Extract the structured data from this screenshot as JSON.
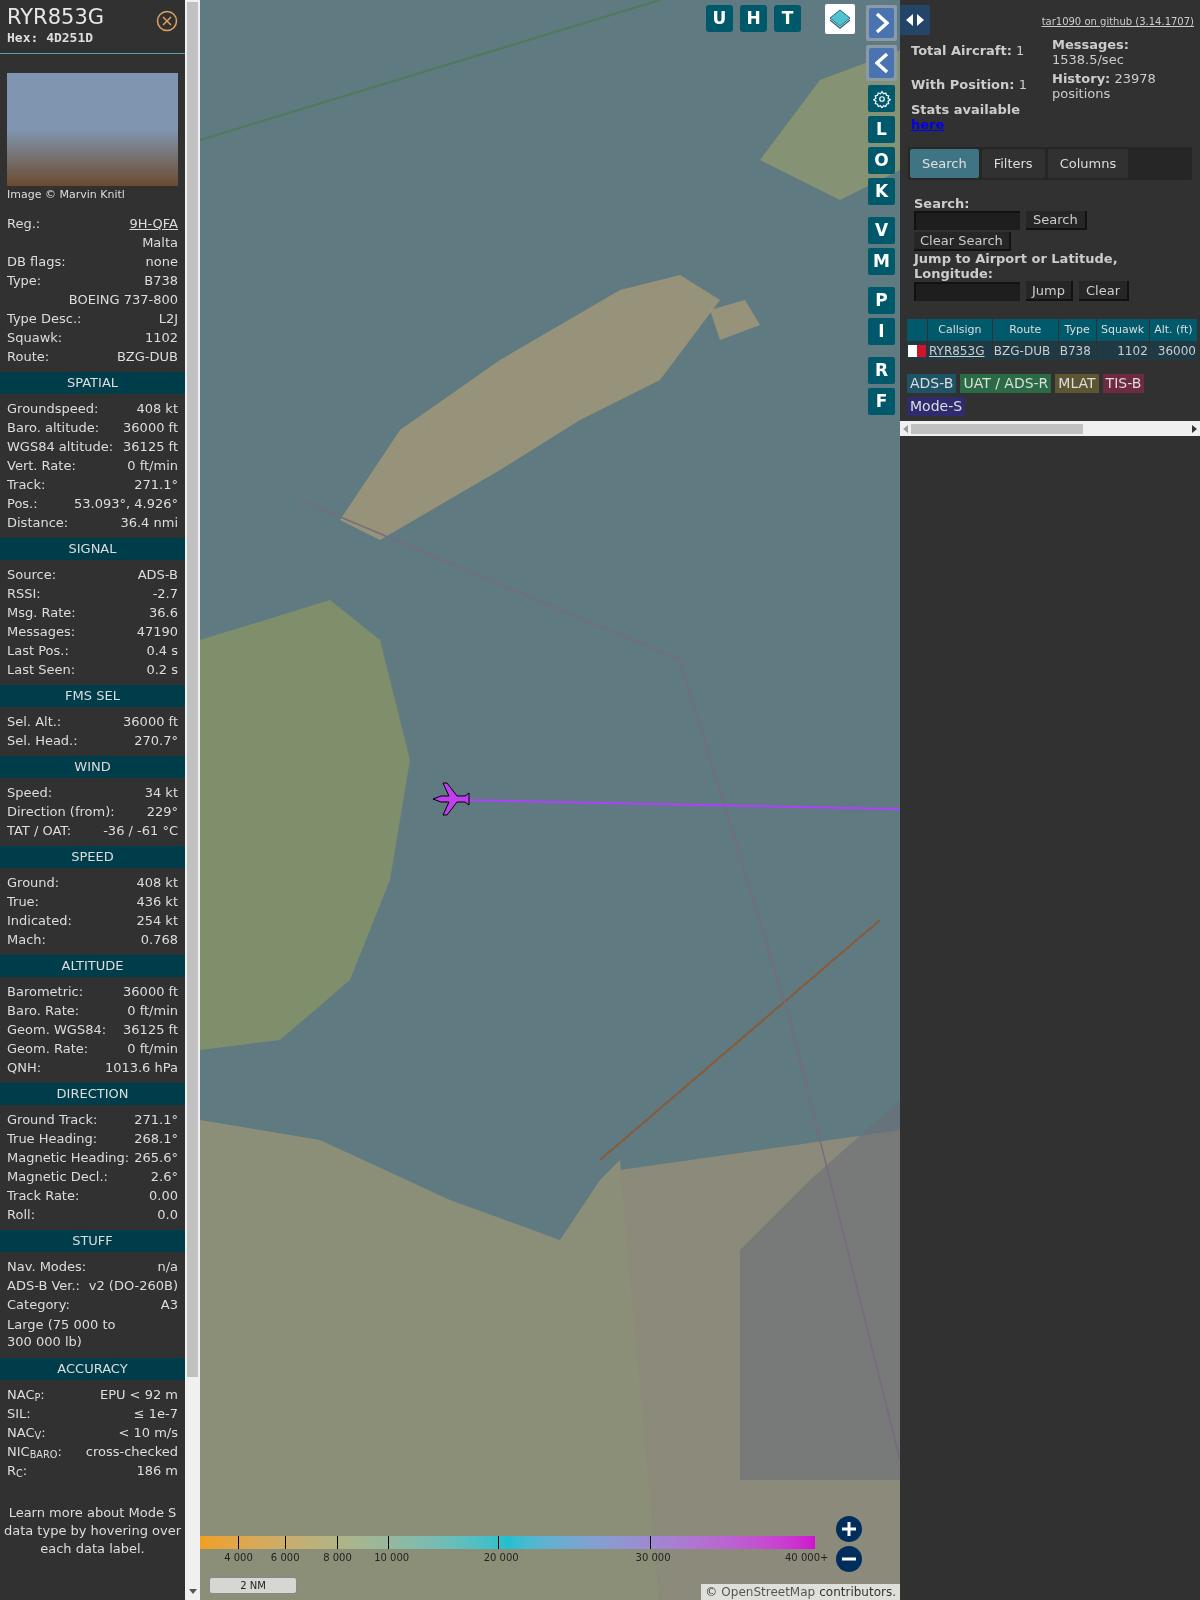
{
  "aircraft": {
    "callsign": "RYR853G",
    "hex": "Hex: 4D251D",
    "photo_credit": "Image © Marvin Knitl"
  },
  "sections": [
    {
      "rows": [
        {
          "kind": "link",
          "label": "Reg.:",
          "value": "9H-QFA"
        },
        {
          "kind": "value",
          "value": "Malta"
        },
        {
          "kind": "pair",
          "label": "DB flags:",
          "value": "none"
        },
        {
          "kind": "pair",
          "label": "Type:",
          "value": "B738"
        },
        {
          "kind": "value",
          "value": "BOEING 737-800"
        },
        {
          "kind": "pair",
          "label": "Type Desc.:",
          "value": "L2J"
        },
        {
          "kind": "pair",
          "label": "Squawk:",
          "value": "1102"
        },
        {
          "kind": "pair",
          "label": "Route:",
          "value": "BZG-DUB"
        }
      ]
    },
    {
      "title": "SPATIAL",
      "rows": [
        {
          "kind": "pair",
          "label": "Groundspeed:",
          "value": "408 kt"
        },
        {
          "kind": "pair",
          "label": "Baro. altitude:",
          "value": "36000 ft"
        },
        {
          "kind": "pair",
          "label": "WGS84 altitude:",
          "value": "36125 ft"
        },
        {
          "kind": "pair",
          "label": "Vert. Rate:",
          "value": "0 ft/min"
        },
        {
          "kind": "pair",
          "label": "Track:",
          "value": "271.1°"
        },
        {
          "kind": "pair",
          "label": "Pos.:",
          "value": "53.093°, 4.926°"
        },
        {
          "kind": "pair",
          "label": "Distance:",
          "value": "36.4 nmi"
        }
      ]
    },
    {
      "title": "SIGNAL",
      "rows": [
        {
          "kind": "pair",
          "label": "Source:",
          "value": "ADS-B"
        },
        {
          "kind": "pair",
          "label": "RSSI:",
          "value": "-2.7"
        },
        {
          "kind": "pair",
          "label": "Msg. Rate:",
          "value": "36.6"
        },
        {
          "kind": "pair",
          "label": "Messages:",
          "value": "47190"
        },
        {
          "kind": "pair",
          "label": "Last Pos.:",
          "value": "0.4 s"
        },
        {
          "kind": "pair",
          "label": "Last Seen:",
          "value": "0.2 s"
        }
      ]
    },
    {
      "title": "FMS SEL",
      "rows": [
        {
          "kind": "pair",
          "label": "Sel. Alt.:",
          "value": "36000 ft"
        },
        {
          "kind": "pair",
          "label": "Sel. Head.:",
          "value": "270.7°"
        }
      ]
    },
    {
      "title": "WIND",
      "rows": [
        {
          "kind": "pair",
          "label": "Speed:",
          "value": "34 kt"
        },
        {
          "kind": "pair",
          "label": "Direction (from):",
          "value": "229°"
        },
        {
          "kind": "pair",
          "label": "TAT / OAT:",
          "value": "-36 / -61 °C"
        }
      ]
    },
    {
      "title": "SPEED",
      "rows": [
        {
          "kind": "pair",
          "label": "Ground:",
          "value": "408 kt"
        },
        {
          "kind": "pair",
          "label": "True:",
          "value": "436 kt"
        },
        {
          "kind": "pair",
          "label": "Indicated:",
          "value": "254 kt"
        },
        {
          "kind": "pair",
          "label": "Mach:",
          "value": "0.768"
        }
      ]
    },
    {
      "title": "ALTITUDE",
      "rows": [
        {
          "kind": "pair",
          "label": "Barometric:",
          "value": "36000 ft"
        },
        {
          "kind": "pair",
          "label": "Baro. Rate:",
          "value": "0 ft/min"
        },
        {
          "kind": "pair",
          "label": "Geom. WGS84:",
          "value": "36125 ft"
        },
        {
          "kind": "pair",
          "label": "Geom. Rate:",
          "value": "0 ft/min"
        },
        {
          "kind": "pair",
          "label": "QNH:",
          "value": "1013.6 hPa"
        }
      ]
    },
    {
      "title": "DIRECTION",
      "rows": [
        {
          "kind": "pair",
          "label": "Ground Track:",
          "value": "271.1°"
        },
        {
          "kind": "pair",
          "label": "True Heading:",
          "value": "268.1°"
        },
        {
          "kind": "pair",
          "label": "Magnetic Heading:",
          "value": "265.6°"
        },
        {
          "kind": "pair",
          "label": "Magnetic Decl.:",
          "value": "2.6°"
        },
        {
          "kind": "pair",
          "label": "Track Rate:",
          "value": "0.00"
        },
        {
          "kind": "pair",
          "label": "Roll:",
          "value": "0.0"
        }
      ]
    },
    {
      "title": "STUFF",
      "rows": [
        {
          "kind": "pair",
          "label": "Nav. Modes:",
          "value": "n/a"
        },
        {
          "kind": "pair",
          "label": "ADS-B Ver.:",
          "value": "v2 (DO-260B)"
        },
        {
          "kind": "pair",
          "label": "Category:",
          "value": "A3"
        },
        {
          "kind": "note",
          "value": "Large (75 000 to 300 000 lb)"
        }
      ]
    },
    {
      "title": "ACCURACY",
      "rows": [
        {
          "kind": "pair",
          "label": "NAC$_{P}$:",
          "value": "EPU < 92 m"
        },
        {
          "kind": "pair",
          "label": "SIL:",
          "value": "≤ 1e-7"
        },
        {
          "kind": "pair",
          "label": "NAC$_{V}$:",
          "value": "< 10 m/s"
        },
        {
          "kind": "pair",
          "label": "NIC$_{BARO}$:",
          "value": "cross-checked"
        },
        {
          "kind": "pair",
          "label": "R$_{C}$:",
          "value": "186 m"
        }
      ]
    }
  ],
  "footer_note": "Learn more about Mode S data type by hovering over each data label.",
  "map": {
    "top_buttons": [
      "U",
      "H",
      "T"
    ],
    "side_buttons": [
      {
        "kind": "next"
      },
      {
        "kind": "prev"
      },
      {
        "kind": "settings"
      },
      {
        "kind": "letter",
        "label": "L"
      },
      {
        "kind": "letter",
        "label": "O"
      },
      {
        "kind": "letter",
        "label": "K"
      },
      {
        "kind": "letter",
        "label": "V"
      },
      {
        "kind": "letter",
        "label": "M"
      },
      {
        "kind": "letter",
        "label": "P"
      },
      {
        "kind": "letter",
        "label": "I"
      },
      {
        "kind": "letter",
        "label": "R"
      },
      {
        "kind": "letter",
        "label": "F"
      }
    ],
    "altitude_legend": [
      "4 000",
      "6 000",
      "8 000",
      "10 000",
      "20 000",
      "30 000",
      "40 000+"
    ],
    "scale": "2 NM",
    "attribution_prefix": "©",
    "attribution_link": "OpenStreetMap",
    "attribution_suffix": "contributors."
  },
  "panel": {
    "github_link": "tar1090 on github (3.14.1707)",
    "stats_left": [
      {
        "label": "Total Aircraft:",
        "value": "1"
      },
      {
        "label": "With Position:",
        "value": "1"
      }
    ],
    "stats_right": [
      {
        "label": "Messages:",
        "value": "1538.5/sec"
      },
      {
        "label": "History:",
        "value": "23978 positions"
      }
    ],
    "stats_text": "Stats available",
    "stats_link": "here",
    "tabs": [
      {
        "label": "Search",
        "selected": true
      },
      {
        "label": "Filters",
        "selected": false
      },
      {
        "label": "Columns",
        "selected": false
      }
    ],
    "search_label": "Search:",
    "search_button": "Search",
    "clear_search_button": "Clear Search",
    "jump_label": "Jump to Airport or Latitude, Longitude:",
    "jump_button": "Jump",
    "clear_button": "Clear",
    "table": {
      "columns": [
        "Callsign",
        "Route",
        "Type",
        "Squawk",
        "Alt. (ft)"
      ],
      "rows": [
        {
          "cells": [
            "RYR853G",
            "BZG-DUB",
            "B738",
            "1102",
            "36000"
          ]
        }
      ]
    },
    "source_tags": [
      {
        "label": "ADS-B",
        "color": "#1f5366"
      },
      {
        "label": "UAT / ADS-R",
        "color": "#2a6b46"
      },
      {
        "label": "MLAT",
        "color": "#5e5633"
      },
      {
        "label": "TIS-B",
        "color": "#6e2a40"
      },
      {
        "label": "Mode-S",
        "color": "#2e2c6e"
      }
    ]
  }
}
